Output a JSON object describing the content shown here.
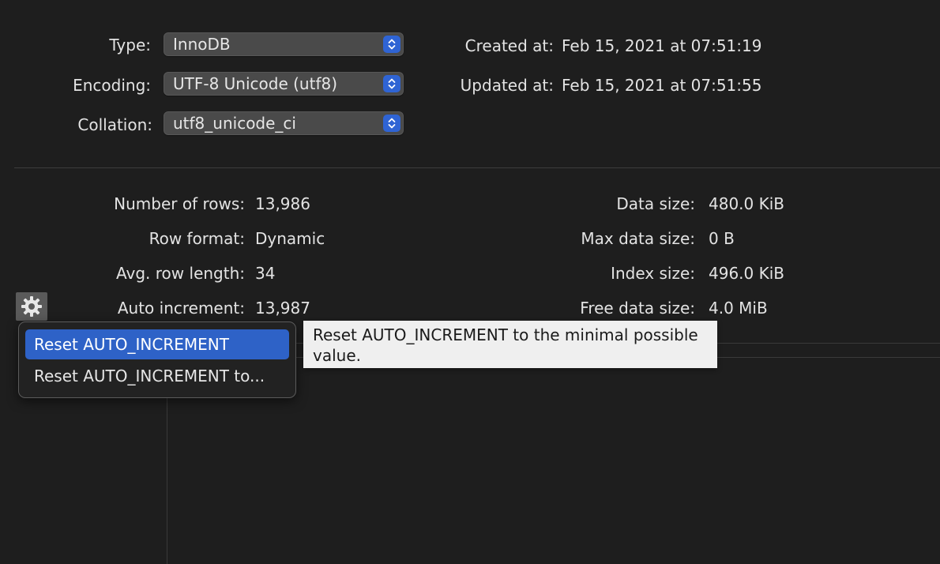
{
  "table_info": {
    "type_label": "Type:",
    "type_value": "InnoDB",
    "encoding_label": "Encoding:",
    "encoding_value": "UTF-8 Unicode (utf8)",
    "collation_label": "Collation:",
    "collation_value": "utf8_unicode_ci",
    "created_label": "Created at:",
    "created_value": "Feb 15, 2021 at 07:51:19",
    "updated_label": "Updated at:",
    "updated_value": "Feb 15, 2021 at 07:51:55"
  },
  "stats": {
    "rows_label": "Number of rows:",
    "rows_value": "13,986",
    "row_format_label": "Row format:",
    "row_format_value": "Dynamic",
    "avg_row_label": "Avg. row length:",
    "avg_row_value": "34",
    "auto_inc_label": "Auto increment:",
    "auto_inc_value": "13,987",
    "data_size_label": "Data size:",
    "data_size_value": "480.0 KiB",
    "max_data_label": "Max data size:",
    "max_data_value": "0 B",
    "index_size_label": "Index size:",
    "index_size_value": "496.0 KiB",
    "free_data_label": "Free data size:",
    "free_data_value": "4.0 MiB"
  },
  "action_menu": {
    "icon": "gear-icon",
    "items": [
      {
        "label": "Reset AUTO_INCREMENT",
        "selected": true
      },
      {
        "label": "Reset AUTO_INCREMENT to...",
        "selected": false
      }
    ]
  },
  "tooltip": {
    "text": "Reset AUTO_INCREMENT to the minimal possible value."
  },
  "colors": {
    "background": "#1e1e1e",
    "accent": "#2e62c7",
    "tooltip_bg": "#efefef"
  }
}
